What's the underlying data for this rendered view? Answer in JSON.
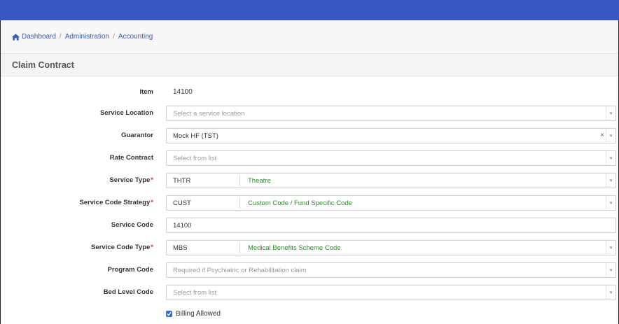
{
  "breadcrumb": {
    "items": [
      {
        "label": "Dashboard",
        "icon": "home-icon"
      },
      {
        "label": "Administration"
      },
      {
        "label": "Accounting"
      }
    ],
    "separator": "/"
  },
  "page": {
    "title": "Claim Contract"
  },
  "form": {
    "item": {
      "label": "Item",
      "value": "14100"
    },
    "service_location": {
      "label": "Service Location",
      "placeholder": "Select a service location"
    },
    "guarantor": {
      "label": "Guarantor",
      "value": "Mock HF (TST)",
      "clear": "×"
    },
    "rate_contract": {
      "label": "Rate Contract",
      "placeholder": "Select from list"
    },
    "service_type": {
      "label": "Service Type",
      "required": "*",
      "code": "THTR",
      "description": "Theatre"
    },
    "service_code_strategy": {
      "label": "Service Code Strategy",
      "required": "*",
      "code": "CUST",
      "description": "Custom Code / Fund Specific Code"
    },
    "service_code": {
      "label": "Service Code",
      "value": "14100"
    },
    "service_code_type": {
      "label": "Service Code Type",
      "required": "*",
      "code": "MBS",
      "description": "Medical Benefits Scheme Code"
    },
    "program_code": {
      "label": "Program Code",
      "placeholder": "Required if Psychiatric or Rehabilitation claim"
    },
    "bed_level_code": {
      "label": "Bed Level Code",
      "placeholder": "Select from list"
    },
    "billing_allowed": {
      "label": "Billing Allowed",
      "checked": true
    }
  },
  "icons": {
    "caret": "▾"
  },
  "colors": {
    "topbar": "#3a56c5",
    "link": "#3b5bb5",
    "required": "#d9302c",
    "description": "#2e8b2e",
    "checkbox": "#2f6fd6"
  }
}
